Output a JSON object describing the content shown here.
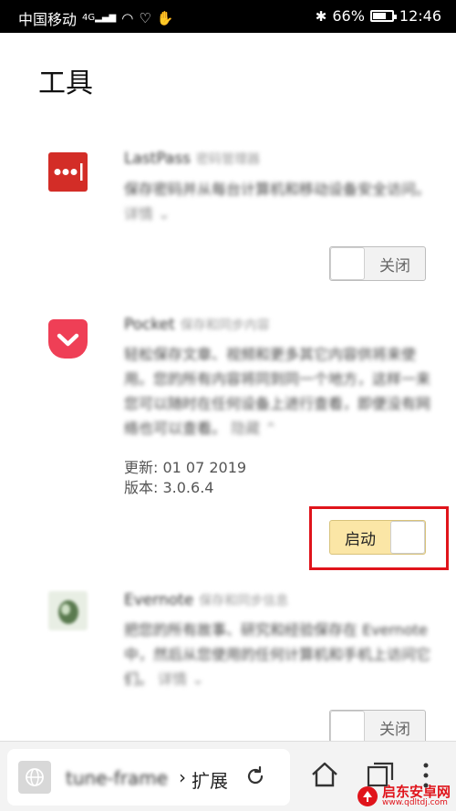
{
  "status_bar": {
    "carrier": "中国移动",
    "network": "4G",
    "battery": "66%",
    "time": "12:46"
  },
  "page": {
    "title": "工具"
  },
  "extensions": [
    {
      "name": "LastPass",
      "tag": "密码管理器",
      "description": "保存密码并从每台计算机和移动设备安全访问。",
      "more": "详情",
      "toggle_label": "关闭",
      "toggle_on": false,
      "icon": "lastpass-icon",
      "icon_color": "#d32d27"
    },
    {
      "name": "Pocket",
      "tag": "保存和同步内容",
      "description": "轻松保存文章、视频和更多其它内容供将来使用。您的所有内容将同到同一个地方，这样一来您可以随时在任何设备上进行查看，即便没有网络也可以查看。",
      "more": "隐藏",
      "updated_label": "更新: 01 07 2019",
      "version_label": "版本: 3.0.6.4",
      "toggle_label": "启动",
      "toggle_on": true,
      "icon": "pocket-icon",
      "icon_color": "#ef3f56"
    },
    {
      "name": "Evernote",
      "tag": "保存和同步信息",
      "description": "把您的所有故事、研究和经验保存在 Evernote 中，然后从您使用的任何计算机和手机上访问它们。",
      "more": "详情",
      "toggle_label": "关闭",
      "toggle_on": false,
      "icon": "evernote-icon",
      "icon_color": "#6bb36a"
    }
  ],
  "address_bar": {
    "host": "tune-frame",
    "separator": "›",
    "page": "扩展"
  },
  "watermark": {
    "name": "启东安卓网",
    "url": "www.qdltdj.com"
  },
  "colors": {
    "highlight": "#e0141b",
    "toggle_on": "#fbe6a6"
  }
}
